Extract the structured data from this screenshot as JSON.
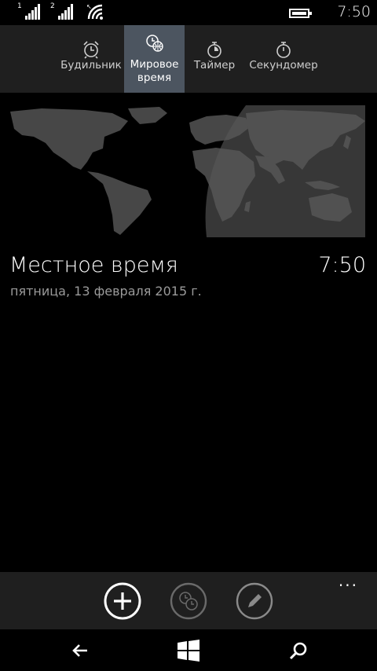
{
  "status_bar": {
    "sim1": "1",
    "sim2": "2",
    "time": "7:50"
  },
  "tabs": [
    {
      "label": "Будильник",
      "icon": "alarm-clock-icon",
      "active": false
    },
    {
      "label": "Мировое время",
      "icon": "world-clock-icon",
      "active": true
    },
    {
      "label": "Таймер",
      "icon": "timer-icon",
      "active": false
    },
    {
      "label": "Секундомер",
      "icon": "stopwatch-icon",
      "active": false
    }
  ],
  "local": {
    "title": "Местное время",
    "time": "7:50",
    "date": "пятница, 13 февраля 2015 г."
  },
  "app_bar": {
    "buttons": [
      "add-icon",
      "compare-time-icon",
      "edit-icon"
    ],
    "more": "..."
  },
  "colors": {
    "tab_active": "#4c5560",
    "bar_bg": "#1f1f1f",
    "map_land": "#4a4a4a",
    "map_day": "#5e5e5e"
  }
}
